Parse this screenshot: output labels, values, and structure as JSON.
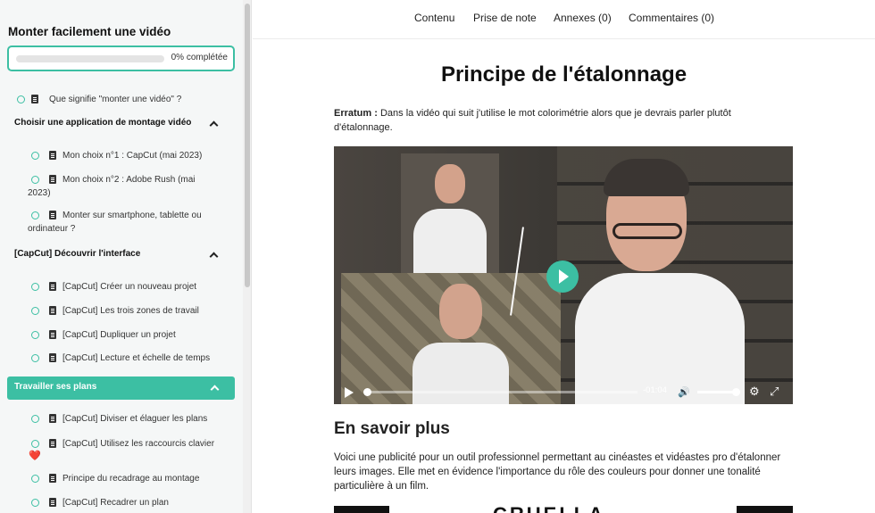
{
  "sidebar": {
    "course_title": "Monter facilement une vidéo",
    "progress": {
      "label": "0% complétée",
      "percent": 0
    },
    "items": [
      {
        "type": "lesson",
        "label": "Que signifie \"monter une vidéo\" ?"
      },
      {
        "type": "section",
        "label": "Choisir une application de montage vidéo"
      },
      {
        "type": "lesson",
        "label": "Mon choix n°1 : CapCut (mai 2023)"
      },
      {
        "type": "lesson",
        "label": "Mon choix n°2 : Adobe Rush (mai",
        "label_cont": "2023)"
      },
      {
        "type": "lesson",
        "label": "Monter sur smartphone, tablette ou",
        "label_cont": "ordinateur ?"
      },
      {
        "type": "section",
        "label": "[CapCut] Découvrir l'interface"
      },
      {
        "type": "lesson",
        "label": "[CapCut] Créer un nouveau projet"
      },
      {
        "type": "lesson",
        "label": "[CapCut] Les trois zones de travail"
      },
      {
        "type": "lesson",
        "label": "[CapCut] Dupliquer un projet"
      },
      {
        "type": "lesson",
        "label": "[CapCut] Lecture et échelle de temps"
      },
      {
        "type": "section_active",
        "label": "Travailler ses plans"
      },
      {
        "type": "lesson",
        "label": "[CapCut] Diviser et élaguer les plans"
      },
      {
        "type": "lesson",
        "label": "[CapCut] Utilisez les raccourcis clavier",
        "suffix": "❤️"
      },
      {
        "type": "lesson",
        "label": "Principe du recadrage au montage"
      },
      {
        "type": "lesson",
        "label": "[CapCut] Recadrer un plan"
      }
    ]
  },
  "nav": {
    "tabs": [
      "Contenu",
      "Prise de note",
      "Annexes (0)",
      "Commentaires (0)"
    ]
  },
  "main": {
    "title": "Principe de l'étalonnage",
    "erratum_label": "Erratum :",
    "erratum_text": " Dans la vidéo qui suit j'utilise le mot colorimétrie alors que je devrais parler plutôt d'étalonnage.",
    "video": {
      "time_remaining": "-01:04",
      "progress": 0.03,
      "volume": 0.85
    },
    "section_title": "En savoir plus",
    "paragraph": "Voici une publicité pour un outil professionnel permettant au cinéastes et vidéastes pro d'étalonner leurs images. Elle met en évidence l'importance du rôle des couleurs pour donner une tonalité particulière à un film.",
    "poster_text": "CRUELLA"
  },
  "colors": {
    "accent": "#3cbfa3"
  }
}
